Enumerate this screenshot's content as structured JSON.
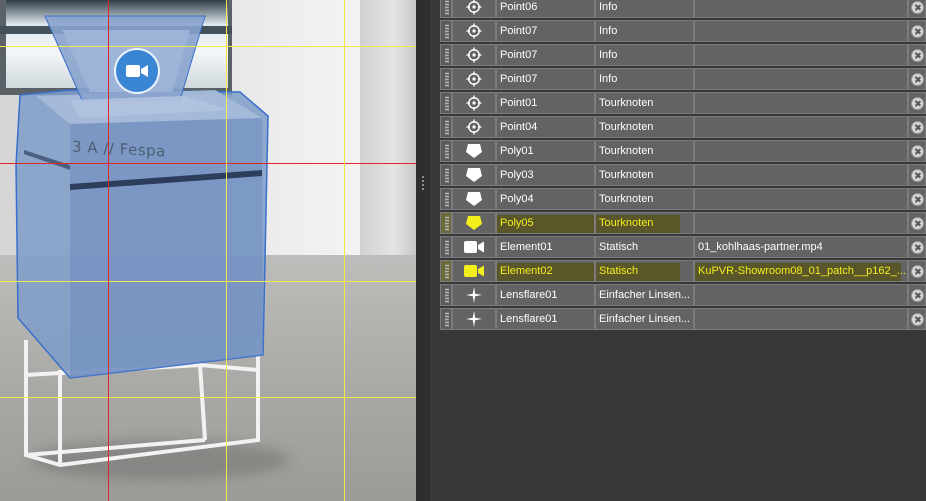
{
  "viewport": {
    "kiosk_label": "3 A // Fespa",
    "marker_icon": "video-camera-icon",
    "guide_color": "#f3e84a",
    "selected_guide_color": "#e0262a"
  },
  "list": {
    "rows": [
      {
        "icon": "crosshair-icon",
        "name": "Point06",
        "type": "Info",
        "source": "",
        "highlighted": false
      },
      {
        "icon": "crosshair-icon",
        "name": "Point07",
        "type": "Info",
        "source": "",
        "highlighted": false
      },
      {
        "icon": "crosshair-icon",
        "name": "Point07",
        "type": "Info",
        "source": "",
        "highlighted": false
      },
      {
        "icon": "crosshair-icon",
        "name": "Point07",
        "type": "Info",
        "source": "",
        "highlighted": false
      },
      {
        "icon": "crosshair-icon",
        "name": "Point01",
        "type": "Tourknoten",
        "source": "",
        "highlighted": false
      },
      {
        "icon": "crosshair-icon",
        "name": "Point04",
        "type": "Tourknoten",
        "source": "",
        "highlighted": false
      },
      {
        "icon": "polygon-icon",
        "name": "Poly01",
        "type": "Tourknoten",
        "source": "",
        "highlighted": false
      },
      {
        "icon": "polygon-icon",
        "name": "Poly03",
        "type": "Tourknoten",
        "source": "",
        "highlighted": false
      },
      {
        "icon": "polygon-icon",
        "name": "Poly04",
        "type": "Tourknoten",
        "source": "",
        "highlighted": false
      },
      {
        "icon": "polygon-icon",
        "name": "Poly05",
        "type": "Tourknoten",
        "source": "",
        "highlighted": true
      },
      {
        "icon": "video-camera-icon",
        "name": "Element01",
        "type": "Statisch",
        "source": "01_kohlhaas-partner.mp4",
        "highlighted": false
      },
      {
        "icon": "video-camera-icon",
        "name": "Element02",
        "type": "Statisch",
        "source": "KuPVR-Showroom08_01_patch__p162_...",
        "highlighted": true
      },
      {
        "icon": "sparkle-icon",
        "name": "Lensflare01",
        "type": "Einfacher Linsen...",
        "source": "",
        "highlighted": false
      },
      {
        "icon": "sparkle-icon",
        "name": "Lensflare01",
        "type": "Einfacher Linsen...",
        "source": "",
        "highlighted": false
      }
    ],
    "highlight_color": "#f4ee1c",
    "delete_icon": "delete-circle-icon"
  }
}
